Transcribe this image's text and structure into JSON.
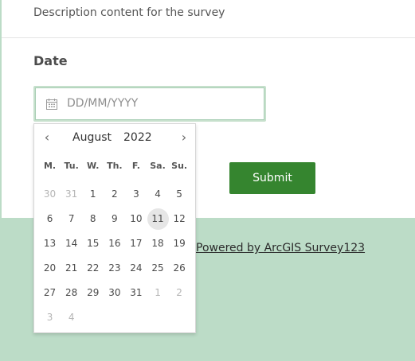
{
  "survey": {
    "description": "Description content for the survey",
    "question_label": "Date",
    "date_placeholder": "DD/MM/YYYY",
    "submit_label": "Submit",
    "powered_by": "Powered by ArcGIS Survey123"
  },
  "datepicker": {
    "prev_symbol": "‹",
    "next_symbol": "›",
    "month": "August",
    "year": "2022",
    "weekdays": [
      "M.",
      "Tu.",
      "W.",
      "Th.",
      "F.",
      "Sa.",
      "Su."
    ],
    "days": [
      {
        "label": "30",
        "muted": true
      },
      {
        "label": "31",
        "muted": true
      },
      {
        "label": "1"
      },
      {
        "label": "2"
      },
      {
        "label": "3"
      },
      {
        "label": "4"
      },
      {
        "label": "5"
      },
      {
        "label": "6"
      },
      {
        "label": "7"
      },
      {
        "label": "8"
      },
      {
        "label": "9"
      },
      {
        "label": "10"
      },
      {
        "label": "11",
        "today": true
      },
      {
        "label": "12"
      },
      {
        "label": "13"
      },
      {
        "label": "14"
      },
      {
        "label": "15"
      },
      {
        "label": "16"
      },
      {
        "label": "17"
      },
      {
        "label": "18"
      },
      {
        "label": "19"
      },
      {
        "label": "20"
      },
      {
        "label": "21"
      },
      {
        "label": "22"
      },
      {
        "label": "23"
      },
      {
        "label": "24"
      },
      {
        "label": "25"
      },
      {
        "label": "26"
      },
      {
        "label": "27"
      },
      {
        "label": "28"
      },
      {
        "label": "29"
      },
      {
        "label": "30"
      },
      {
        "label": "31"
      },
      {
        "label": "1",
        "muted": true
      },
      {
        "label": "2",
        "muted": true
      },
      {
        "label": "3",
        "muted": true
      },
      {
        "label": "4",
        "muted": true
      }
    ]
  },
  "colors": {
    "page_background": "#bcdcc7",
    "submit_button": "#35852f",
    "input_focus_border": "#c6e0cc"
  }
}
